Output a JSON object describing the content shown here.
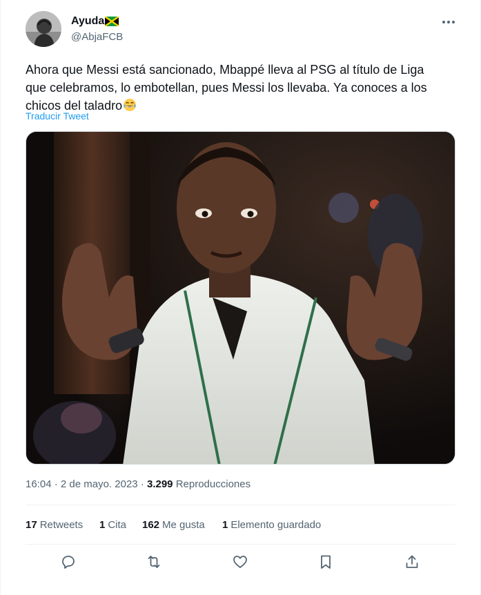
{
  "author": {
    "display_name": "Ayuda",
    "handle": "@AbjaFCB",
    "flag_icon": "jamaica-flag-icon"
  },
  "tweet": {
    "text_lines": [
      "Ahora que Messi está sancionado, Mbappé lleva al PSG al título de Liga",
      "que celebramos, lo embotellan, pues Messi los llevaba. Ya conoces a los",
      "chicos del taladro"
    ],
    "emoji_icon": "tears-of-joy-emoji-icon",
    "translate_label": "Traducir Tweet"
  },
  "meta": {
    "time": "16:04",
    "separator": "·",
    "date": "2 de mayo. 2023",
    "views_count": "3.299",
    "views_label": "Reproducciones"
  },
  "stats": {
    "retweets_count": "17",
    "retweets_label": "Retweets",
    "quotes_count": "1",
    "quotes_label": "Cita",
    "likes_count": "162",
    "likes_label": "Me gusta",
    "bookmarks_count": "1",
    "bookmarks_label": "Elemento guardado"
  },
  "colors": {
    "accent": "#1d9bf0",
    "text_primary": "#0f1419",
    "text_secondary": "#536471",
    "divider": "#eff3f4"
  },
  "actions": {
    "reply_icon": "reply-icon",
    "retweet_icon": "retweet-icon",
    "like_icon": "heart-icon",
    "bookmark_icon": "bookmark-icon",
    "share_icon": "share-icon"
  }
}
